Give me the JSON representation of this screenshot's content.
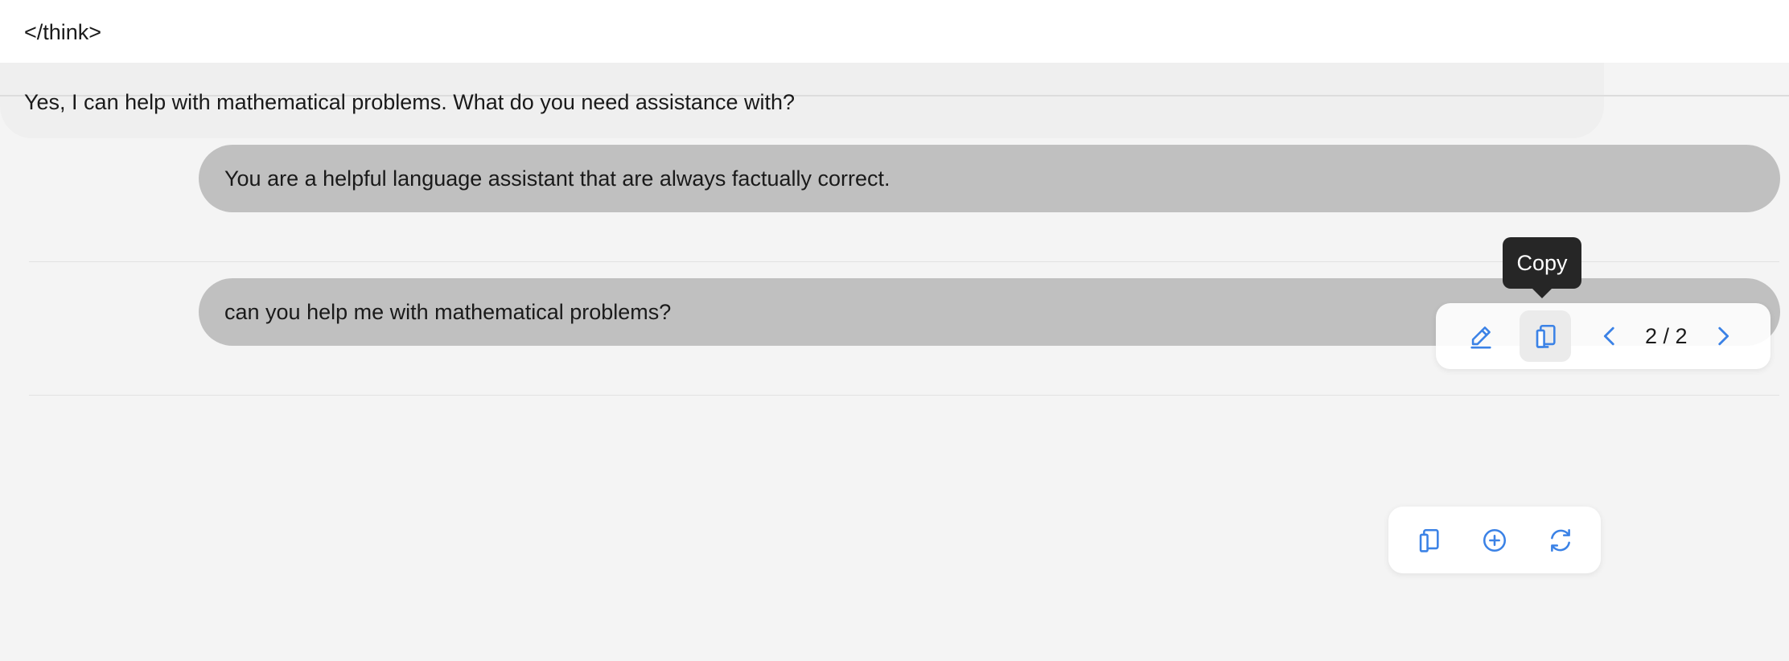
{
  "messages": {
    "system_prompt": "You are a helpful language assistant that are always factually correct.",
    "user_message": "can you help me with mathematical problems?",
    "assistant_line1": "</think>",
    "assistant_line2": "Yes, I can help with mathematical problems. What do you need assistance with?"
  },
  "user_toolbar": {
    "page_indicator": "2 / 2",
    "tooltip": "Copy",
    "icons": [
      "edit-icon",
      "copy-icon",
      "chevron-left-icon",
      "chevron-right-icon"
    ]
  },
  "assistant_toolbar": {
    "icons": [
      "copy-icon",
      "add-circle-icon",
      "regenerate-icon"
    ]
  },
  "colors": {
    "accent": "#3b82e6",
    "user_bubble": "#c0c0c0",
    "assistant_bubble": "#efefef",
    "background": "#f4f4f4",
    "tooltip_bg": "#262626"
  }
}
